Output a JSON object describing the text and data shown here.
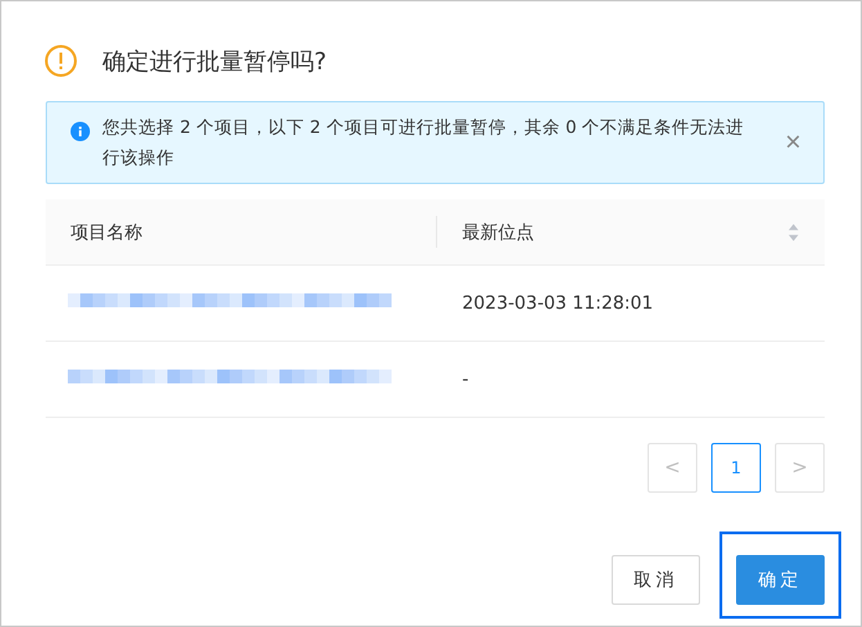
{
  "dialog": {
    "title": "确定进行批量暂停吗?"
  },
  "alert": {
    "text": "您共选择 2 个项目，以下 2 个项目可进行批量暂停，其余 0 个不满足条件无法进行该操作",
    "close": "×"
  },
  "table": {
    "columns": [
      {
        "label": "项目名称",
        "sortable": false
      },
      {
        "label": "最新位点",
        "sortable": true
      }
    ],
    "rows": [
      {
        "time": "2023-03-03 11:28:01"
      },
      {
        "time": "-"
      }
    ]
  },
  "pagination": {
    "prev": {
      "label": "<",
      "disabled": true
    },
    "pages": [
      {
        "label": "1",
        "selected": true
      }
    ],
    "next": {
      "label": ">",
      "disabled": true
    }
  },
  "buttons": [
    {
      "label": "取消",
      "kind": "default",
      "focused": false
    },
    {
      "label": "确定",
      "kind": "primary",
      "focused": true
    }
  ]
}
